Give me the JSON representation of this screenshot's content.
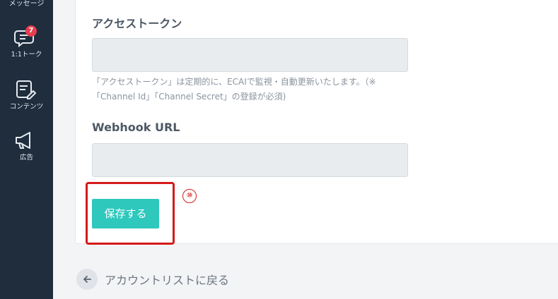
{
  "sidebar": {
    "top_label": "メッセージ",
    "items": [
      {
        "label": "1:1トーク",
        "icon": "chat-bubble-icon",
        "badge": "7"
      },
      {
        "label": "コンテンツ",
        "icon": "edit-document-icon"
      },
      {
        "label": "広告",
        "icon": "megaphone-icon"
      }
    ]
  },
  "form": {
    "access_token": {
      "label": "アクセストークン",
      "value": "",
      "help": "「アクセストークン」は定期的に、ECAIで監視・自動更新いたします。（※「Channel Id」「Channel Secret」の登録が必須)"
    },
    "webhook": {
      "label": "Webhook URL",
      "value": ""
    },
    "save_label": "保存する",
    "annotation_number": "⑩"
  },
  "back_link": {
    "label": "アカウントリストに戻る"
  },
  "colors": {
    "sidebar_bg": "#1f2d3d",
    "accent": "#2ec8bd",
    "badge": "#e53e4f",
    "annotation": "#d61a1a"
  }
}
